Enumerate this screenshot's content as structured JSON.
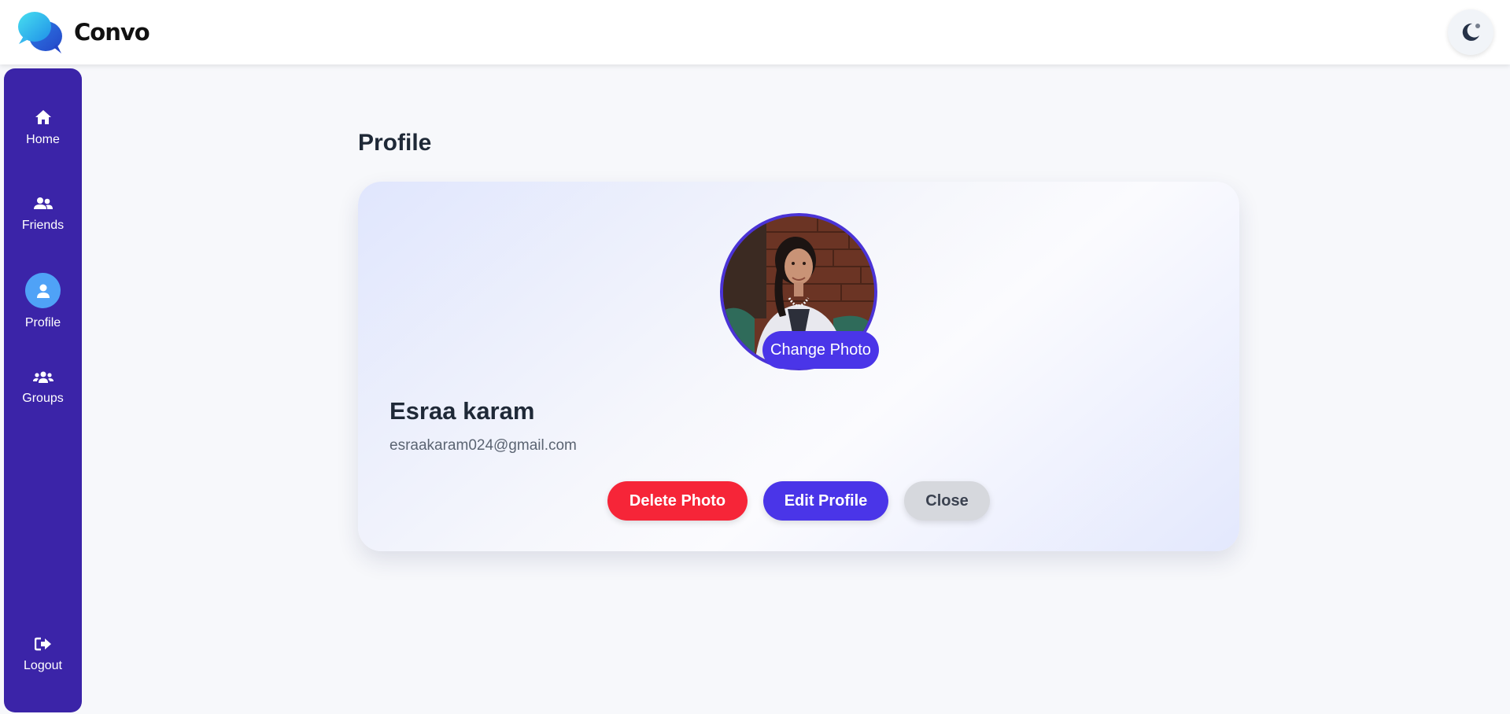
{
  "app": {
    "name": "Convo"
  },
  "header": {
    "theme_toggle_icon": "moon-icon"
  },
  "sidebar": {
    "items": [
      {
        "label": "Home",
        "icon": "home-icon",
        "active": false
      },
      {
        "label": "Friends",
        "icon": "user-friends-icon",
        "active": false
      },
      {
        "label": "Profile",
        "icon": "user-icon",
        "active": true
      },
      {
        "label": "Groups",
        "icon": "users-icon",
        "active": false
      }
    ],
    "logout": {
      "label": "Logout",
      "icon": "sign-out-icon"
    }
  },
  "page": {
    "title": "Profile"
  },
  "profile": {
    "name": "Esraa karam",
    "email": "esraakaram024@gmail.com",
    "change_photo_label": "Change Photo"
  },
  "actions": {
    "delete_photo": "Delete Photo",
    "edit_profile": "Edit Profile",
    "close": "Close"
  },
  "colors": {
    "sidebar": "#3b24a8",
    "accent": "#4a35e8",
    "danger": "#f62538",
    "active_nav": "#4fa2f7"
  }
}
